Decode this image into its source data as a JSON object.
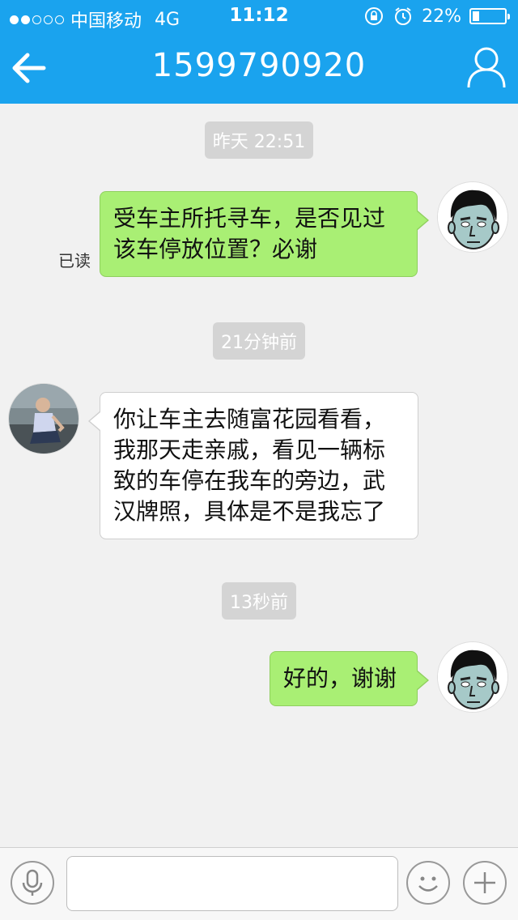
{
  "status_bar": {
    "carrier": "中国移动",
    "network": "4G",
    "time": "11:12",
    "battery": "22%",
    "battery_level": 0.22
  },
  "header": {
    "title": "1599790920",
    "back_icon": "back-arrow-icon",
    "profile_icon": "person-icon",
    "color": "#1aa3ee"
  },
  "messages": [
    {
      "timestamp": "昨天 22:51"
    },
    {
      "sender": "me",
      "lines": [
        "受车主所托寻车，是否见过",
        "该车停放位置？必谢"
      ],
      "status": "已读"
    },
    {
      "timestamp": "21分钟前"
    },
    {
      "sender": "other",
      "lines": [
        "你让车主去随富花园看看，",
        "我那天走亲戚，看见一辆标",
        "致的车停在我车的旁边，武",
        "汉牌照，具体是不是我忘了"
      ]
    },
    {
      "timestamp": "13秒前"
    },
    {
      "sender": "me",
      "lines": [
        "好的，谢谢"
      ]
    }
  ],
  "input_bar": {
    "placeholder": "",
    "voice_icon": "microphone-icon",
    "emoji_icon": "smiley-icon",
    "add_icon": "plus-icon"
  },
  "colors": {
    "my_bubble": "#a9ef74",
    "other_bubble": "#ffffff",
    "background": "#f1f1f1"
  }
}
